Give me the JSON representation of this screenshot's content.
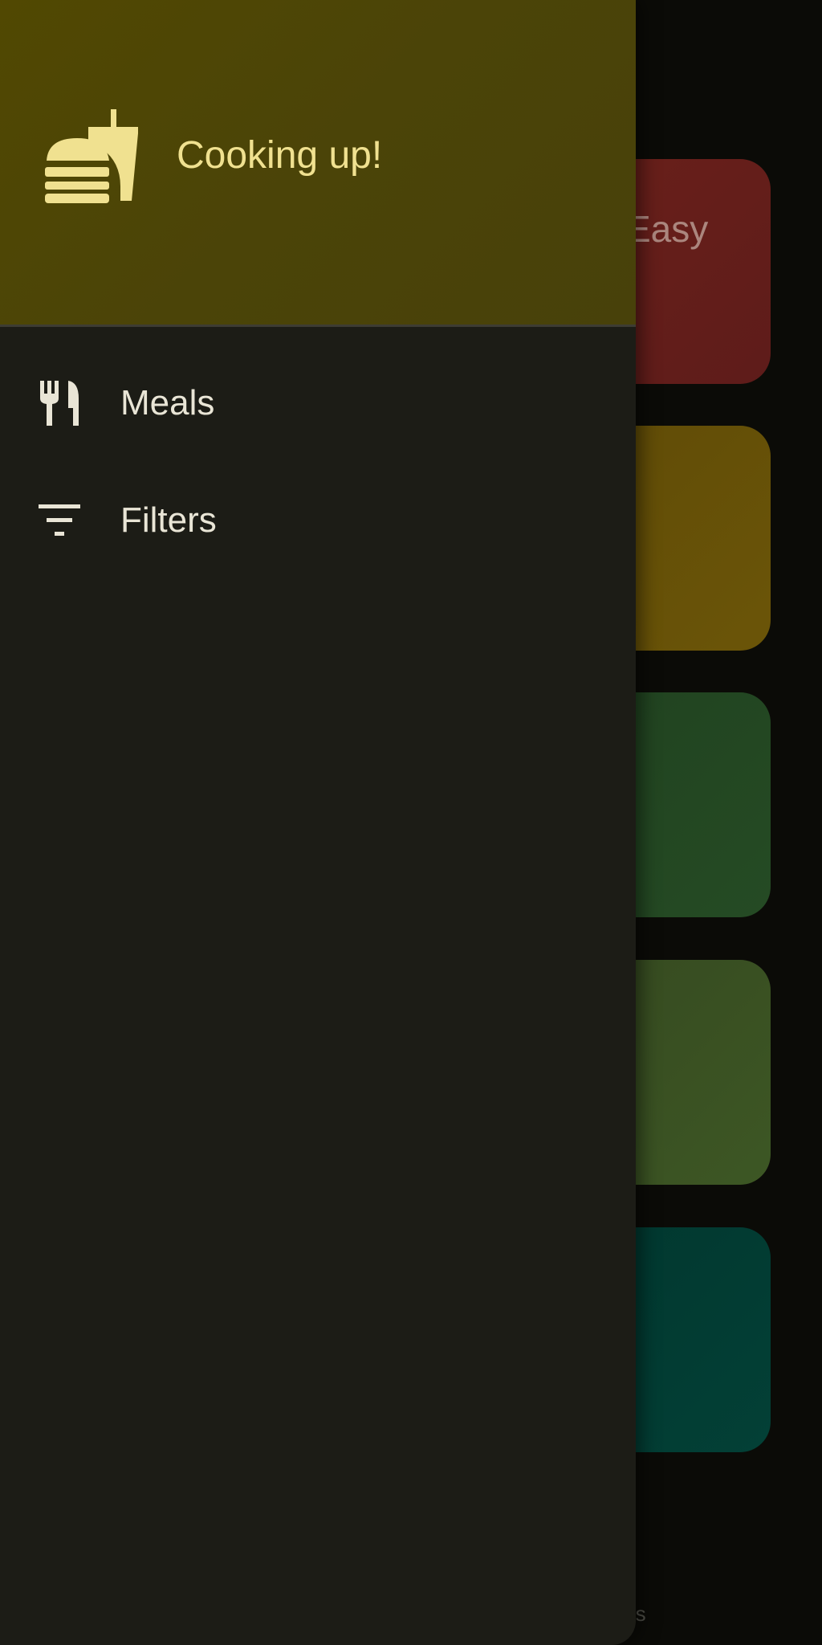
{
  "app": {
    "drawer_title": "Cooking up!",
    "header_icon": "fastfood-icon",
    "accent_color": "#f0e190",
    "header_color": "#4b4408",
    "drawer_color": "#1c1c16"
  },
  "drawer": {
    "items": [
      {
        "label": "Meals",
        "icon": "restaurant-icon"
      },
      {
        "label": "Filters",
        "icon": "filter-list-icon"
      }
    ]
  },
  "background": {
    "tiles": [
      {
        "label": "Easy",
        "color": "#6b1f1a"
      },
      {
        "label": "",
        "color": "#6b5508"
      },
      {
        "label": "",
        "color": "#22471f"
      },
      {
        "label": "",
        "color": "#3a5221"
      },
      {
        "label": "",
        "color": "#023a31"
      }
    ],
    "bottom_label": "tes"
  }
}
